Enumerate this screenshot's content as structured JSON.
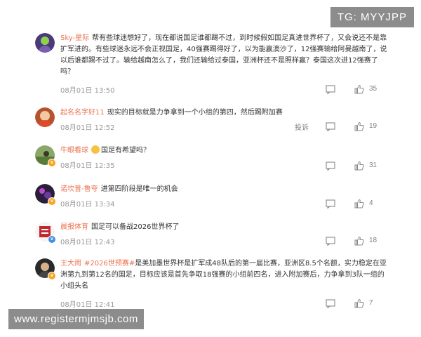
{
  "watermarks": {
    "top": "TG: MYYJPP",
    "bottom": "www.registermjmsjb.com"
  },
  "actions": {
    "report_label": "投诉"
  },
  "comments": [
    {
      "user": "Sky-星际",
      "text": "帮有些球迷想好了，现在都说国足谁都踢不过，到时候假如国足真进世界杯了，又会说还不是靠扩军进的。有些球迷永远不会正视国足，40强赛踢得好了，以为能赢澳沙了，12强赛输给阿曼越南了，说以后谁都踢不过了。输给越南怎么了，我们还输给过泰国，亚洲杯还不是照样赢？泰国这次进12强赛了吗？",
      "date": "08月01日 13:50",
      "likes": "35",
      "avatar_color": "#4a3a7a"
    },
    {
      "user": "起名名字好11",
      "text": "现实的目标就是力争拿到一个小组的第四，然后踢附加赛",
      "date": "08月01日 12:52",
      "likes": "19",
      "avatar_color": "#b5532e"
    },
    {
      "user": "牛眼看球",
      "text": "国足有希望吗？",
      "date": "08月01日 12:35",
      "likes": "31",
      "avatar_color": "#6a8a4a"
    },
    {
      "user": "诺坎普-鲁夸",
      "text": "进第四阶段是唯一的机会",
      "date": "08月01日 13:34",
      "likes": "4",
      "avatar_color": "#3a2a4a"
    },
    {
      "user": "晨报体育",
      "text": "国足可以备战2026世界杯了",
      "date": "08月01日 12:43",
      "likes": "18",
      "avatar_color": "#c0282e"
    },
    {
      "user": "王大闹",
      "hashtag": "#2026世预赛#",
      "text": "是美加墨世界杯是扩军成48队后的第一届比赛，亚洲区8.5个名额，实力稳定在亚洲第九到第12名的国足，目标应该是首先争取18强赛的小组前四名，进入附加赛后，力争拿到3队一组的小组头名",
      "date": "08月01日 12:41",
      "likes": "7",
      "avatar_color": "#2a2a2a"
    }
  ]
}
